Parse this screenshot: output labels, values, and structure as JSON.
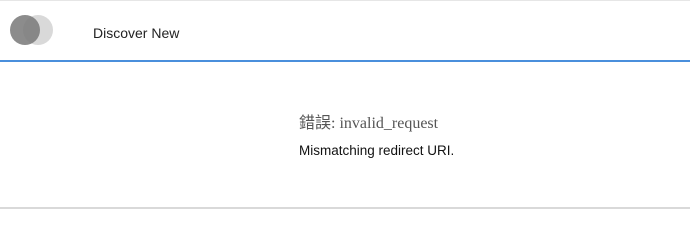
{
  "header": {
    "logo_icon": "overlapping-circles-logo-icon",
    "nav_label": "Discover New",
    "accent_color": "#4a8fdc"
  },
  "error": {
    "title": "錯誤: invalid_request",
    "message": "Mismatching redirect URI."
  }
}
